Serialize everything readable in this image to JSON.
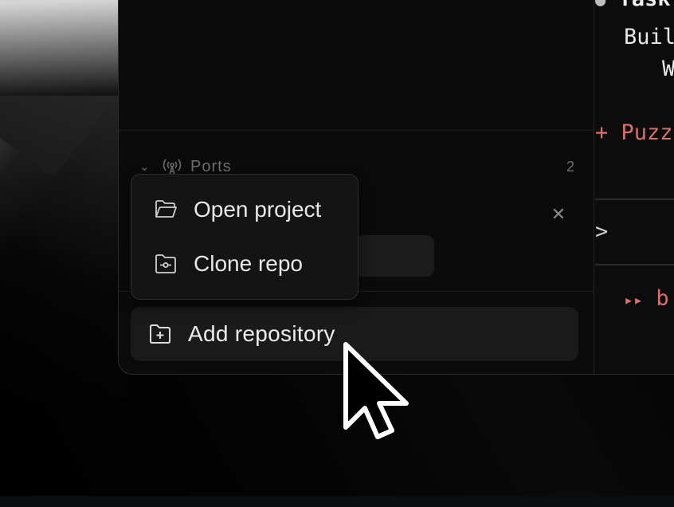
{
  "ports_section": {
    "label": "Ports",
    "count": "2"
  },
  "menu": {
    "items": [
      {
        "label": "Open project",
        "icon": "folder-open-icon"
      },
      {
        "label": "Clone repo",
        "icon": "folder-git-icon"
      }
    ]
  },
  "add_repository": {
    "label": "Add repository",
    "icon": "folder-plus-icon"
  },
  "editor": {
    "lines": [
      {
        "prefix": "●",
        "text": "Task"
      },
      {
        "text": "Buil"
      },
      {
        "text": "W"
      },
      {
        "prefix": "+",
        "text": "Puzz"
      },
      {
        "text": ">"
      },
      {
        "prefix": "▸▸",
        "text": "b"
      }
    ]
  },
  "colors": {
    "accent_red": "#d9706b",
    "background": "#0c0c0c",
    "panel": "#1a1a1a"
  }
}
